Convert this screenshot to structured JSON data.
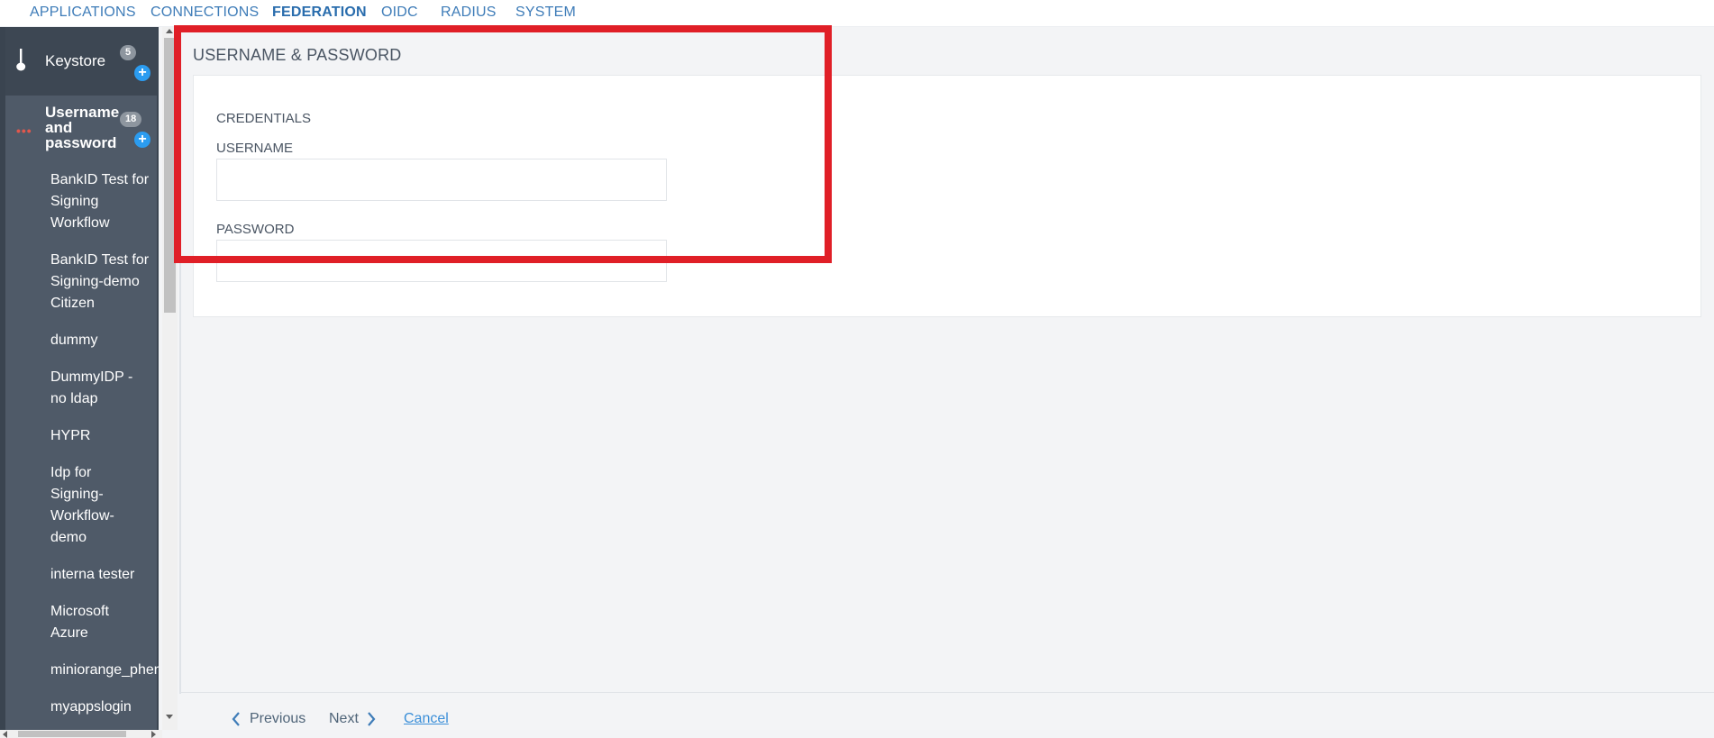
{
  "topnav": {
    "tabs": [
      {
        "label": "APPLICATIONS"
      },
      {
        "label": "CONNECTIONS"
      },
      {
        "label": "FEDERATION"
      },
      {
        "label": "OIDC"
      },
      {
        "label": "RADIUS"
      },
      {
        "label": "SYSTEM"
      }
    ],
    "active_tab": "FEDERATION"
  },
  "sidebar": {
    "keystore": {
      "label": "Keystore",
      "count": "5",
      "icon": "hammer-icon"
    },
    "username_password": {
      "label": "Username and password",
      "count": "18",
      "menu_icon": "dots-icon"
    },
    "items": [
      {
        "label": "BankID Test for Signing Workflow"
      },
      {
        "label": "BankID Test for Signing-demo Citizen"
      },
      {
        "label": "dummy"
      },
      {
        "label": "DummyIDP - no ldap"
      },
      {
        "label": "HYPR"
      },
      {
        "label": "Idp for Signing-Workflow-demo"
      },
      {
        "label": "interna tester"
      },
      {
        "label": "Microsoft Azure"
      },
      {
        "label": "miniorange_phen"
      },
      {
        "label": "myappslogin"
      }
    ]
  },
  "main": {
    "section_title": "USERNAME & PASSWORD",
    "credentials_heading": "CREDENTIALS",
    "username_label": "USERNAME",
    "username_value": "",
    "password_label": "PASSWORD",
    "password_value": ""
  },
  "footer": {
    "previous_label": "Previous",
    "next_label": "Next",
    "cancel_label": "Cancel"
  },
  "colors": {
    "accent": "#3e7cb8",
    "sidebar_bg": "#4f5a68",
    "add_button": "#2b9cf0",
    "highlight": "#e01f27"
  }
}
